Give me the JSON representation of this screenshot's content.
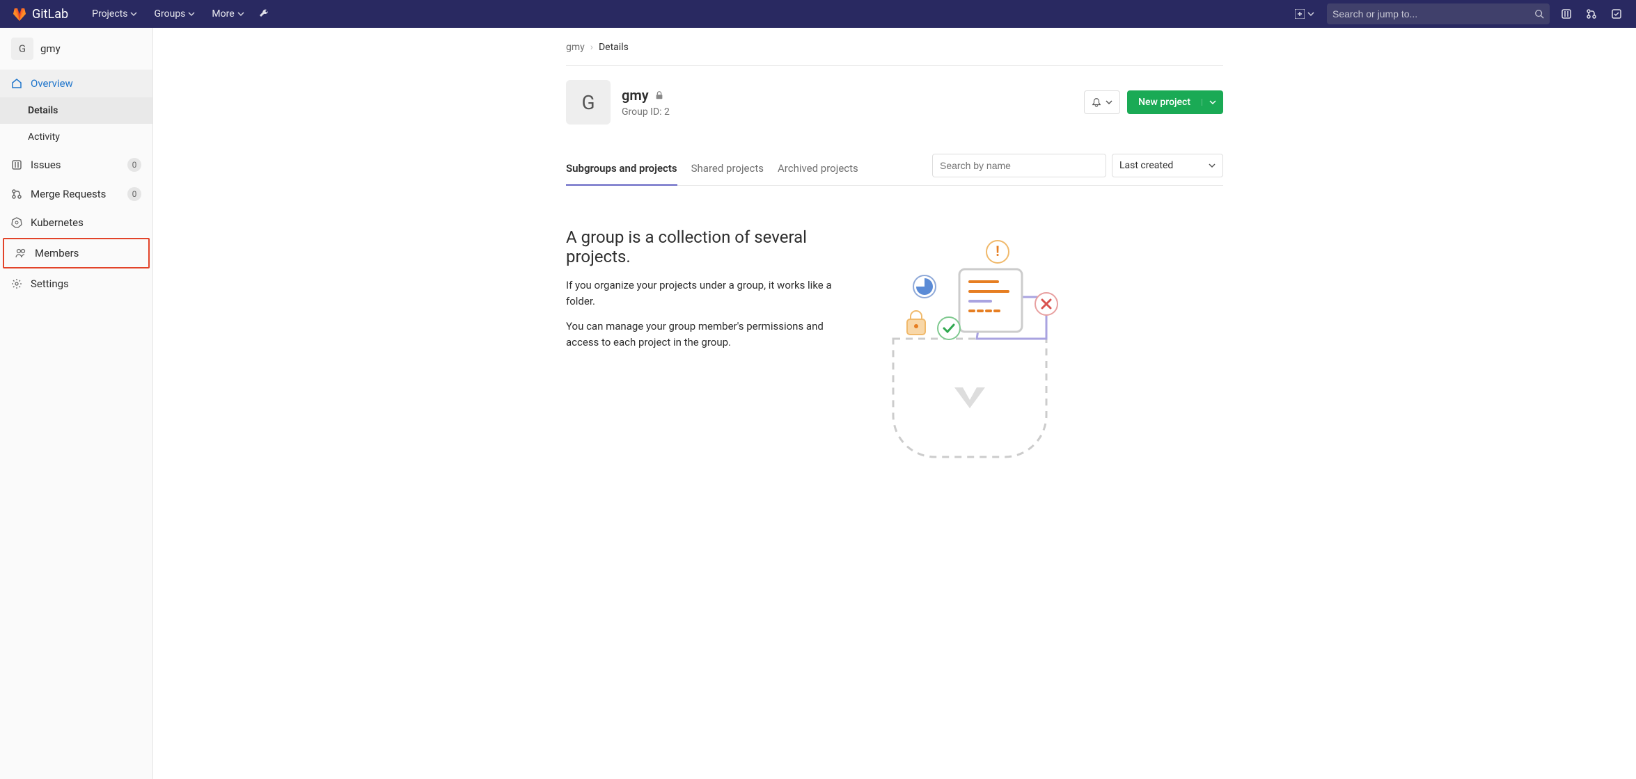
{
  "navbar": {
    "brand": "GitLab",
    "items": [
      "Projects",
      "Groups",
      "More"
    ],
    "search_placeholder": "Search or jump to..."
  },
  "sidebar": {
    "group_initial": "G",
    "group_name": "gmy",
    "items": [
      {
        "label": "Overview",
        "icon": "home",
        "active": true,
        "sub": [
          {
            "label": "Details",
            "active": true
          },
          {
            "label": "Activity",
            "active": false
          }
        ]
      },
      {
        "label": "Issues",
        "icon": "issues",
        "badge": "0"
      },
      {
        "label": "Merge Requests",
        "icon": "merge",
        "badge": "0"
      },
      {
        "label": "Kubernetes",
        "icon": "kube"
      },
      {
        "label": "Members",
        "icon": "members",
        "highlight": true
      },
      {
        "label": "Settings",
        "icon": "gear"
      }
    ]
  },
  "main": {
    "breadcrumb": [
      "gmy",
      "Details"
    ],
    "group_initial": "G",
    "group_title": "gmy",
    "group_id_label": "Group ID: 2",
    "new_project_label": "New project",
    "tabs": [
      "Subgroups and projects",
      "Shared projects",
      "Archived projects"
    ],
    "search_by_name_placeholder": "Search by name",
    "sort_label": "Last created",
    "empty_title": "A group is a collection of several projects.",
    "empty_p1": "If you organize your projects under a group, it works like a folder.",
    "empty_p2": "You can manage your group member's permissions and access to each project in the group."
  }
}
